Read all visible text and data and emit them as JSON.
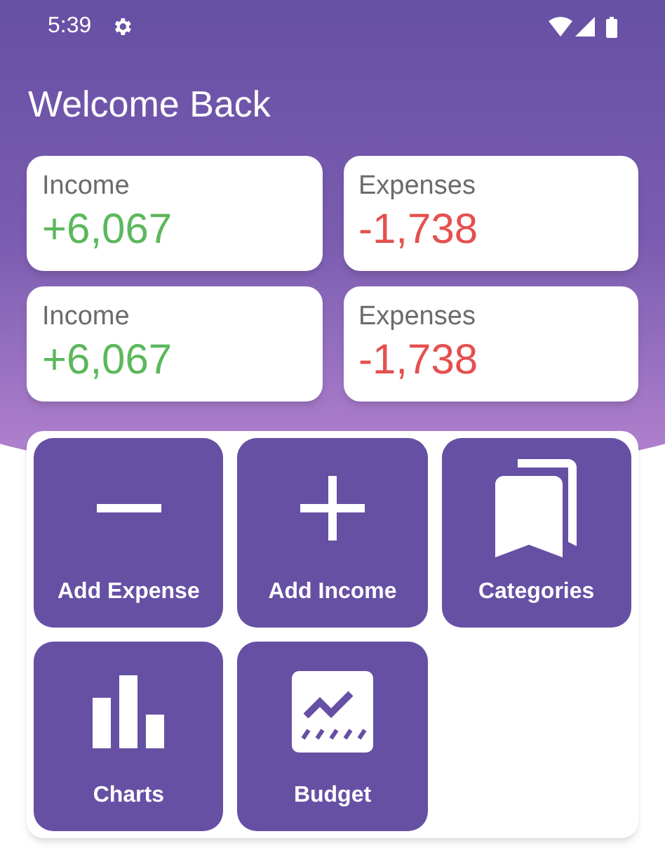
{
  "status_bar": {
    "time": "5:39"
  },
  "title": "Welcome Back",
  "summary_cards": [
    {
      "label": "Income",
      "value": "+6,067",
      "kind": "income"
    },
    {
      "label": "Expenses",
      "value": "-1,738",
      "kind": "expense"
    },
    {
      "label": "Income",
      "value": "+6,067",
      "kind": "income"
    },
    {
      "label": "Expenses",
      "value": "-1,738",
      "kind": "expense"
    }
  ],
  "actions": [
    {
      "label": "Add Expense",
      "kind": "minus"
    },
    {
      "label": "Add Income",
      "kind": "plus"
    },
    {
      "label": "Categories",
      "kind": "bookmarks"
    },
    {
      "label": "Charts",
      "kind": "bars"
    },
    {
      "label": "Budget",
      "kind": "trend"
    }
  ]
}
